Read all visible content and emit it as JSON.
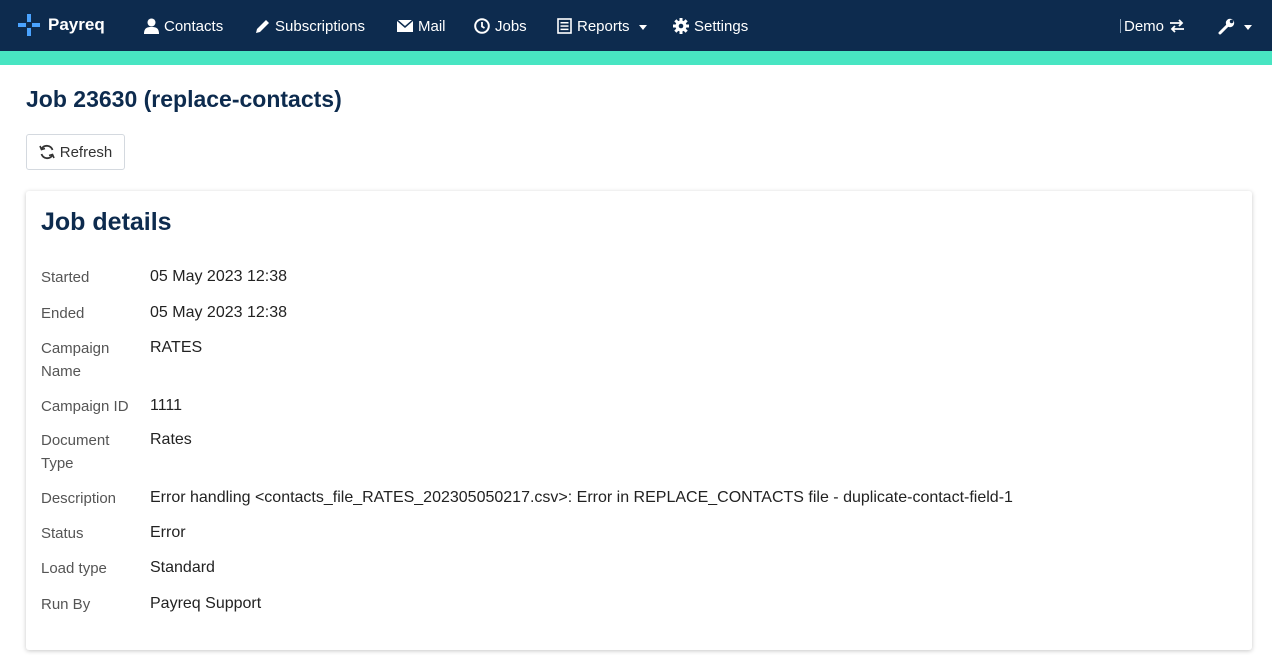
{
  "navbar": {
    "brand": "Payreq",
    "items": [
      {
        "label": "Contacts",
        "icon": "user-icon"
      },
      {
        "label": "Subscriptions",
        "icon": "pencil-icon"
      },
      {
        "label": "Mail",
        "icon": "envelope-icon"
      },
      {
        "label": "Jobs",
        "icon": "clock-icon"
      },
      {
        "label": "Reports",
        "icon": "list-icon"
      },
      {
        "label": "Settings",
        "icon": "gear-icon"
      }
    ],
    "account": "Demo",
    "colors": {
      "background": "#0d2b4e",
      "accent": "#48e5c2"
    }
  },
  "page": {
    "title": "Job 23630 (replace-contacts)",
    "refresh_label": "Refresh"
  },
  "card": {
    "title": "Job details",
    "fields": [
      {
        "label": "Started",
        "value": "05 May 2023 12:38"
      },
      {
        "label": "Ended",
        "value": "05 May 2023 12:38"
      },
      {
        "label": "Campaign Name",
        "value": "RATES"
      },
      {
        "label": "Campaign ID",
        "value": "1111"
      },
      {
        "label": "Document Type",
        "value": "Rates"
      },
      {
        "label": "Description",
        "value": "Error handling <contacts_file_RATES_202305050217.csv>: Error in REPLACE_CONTACTS file - duplicate-contact-field-1"
      },
      {
        "label": "Status",
        "value": "Error"
      },
      {
        "label": "Load type",
        "value": "Standard"
      },
      {
        "label": "Run By",
        "value": "Payreq Support"
      }
    ]
  }
}
